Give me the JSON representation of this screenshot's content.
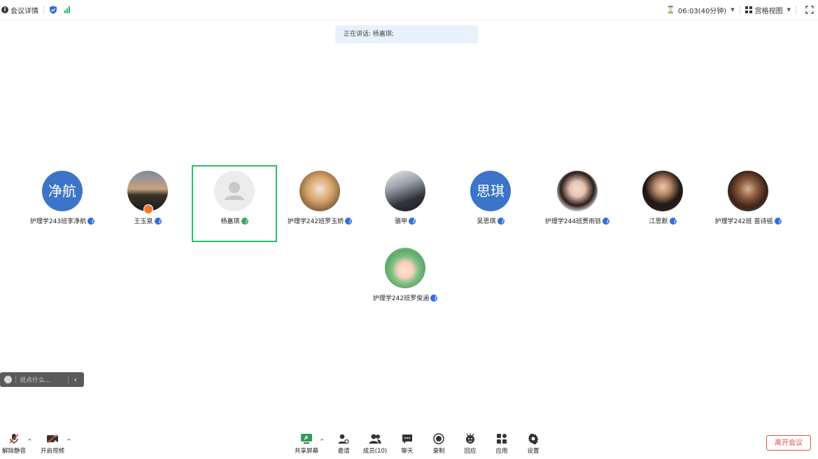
{
  "topbar": {
    "meeting_details": "会议详情",
    "timer": "06:03(40分钟)",
    "view_mode": "宫格视图"
  },
  "speaking": {
    "text": "正在讲话: 杨嘉琪;"
  },
  "participants": [
    {
      "name": "护理学243班李净航",
      "avatar_text": "净航",
      "avatar_color": "#3b74c8"
    },
    {
      "name": "王玉泉",
      "avatar_text": "",
      "host_badge_color": "#f07c25"
    },
    {
      "name": "杨嘉琪",
      "avatar_text": "",
      "active": true,
      "active_border_color": "#27c069"
    },
    {
      "name": "护理学242班罗玉娇",
      "avatar_text": ""
    },
    {
      "name": "骆甲",
      "avatar_text": ""
    },
    {
      "name": "吴思琪",
      "avatar_text": "思琪",
      "avatar_color": "#3b74c8"
    },
    {
      "name": "护理学244班贾雨铄",
      "avatar_text": ""
    },
    {
      "name": "江思默",
      "avatar_text": ""
    },
    {
      "name": "护理学242班 苗诗徭",
      "avatar_text": ""
    },
    {
      "name": "护理学242班罗俊涵",
      "avatar_text": ""
    }
  ],
  "chat": {
    "placeholder": "说点什么..."
  },
  "toolbar": {
    "unmute": "解除静音",
    "start_video": "开启视频",
    "share_screen": "共享屏幕",
    "invite": "邀请",
    "members": "成员(10)",
    "chat": "聊天",
    "record": "录制",
    "respond": "回应",
    "apps": "应用",
    "settings": "设置",
    "leave": "离开会议"
  },
  "colors": {
    "accent_blue": "#2f6fe4",
    "active_green": "#27c069",
    "leave_red": "#e4503d",
    "signal_green": "#27b05f"
  }
}
